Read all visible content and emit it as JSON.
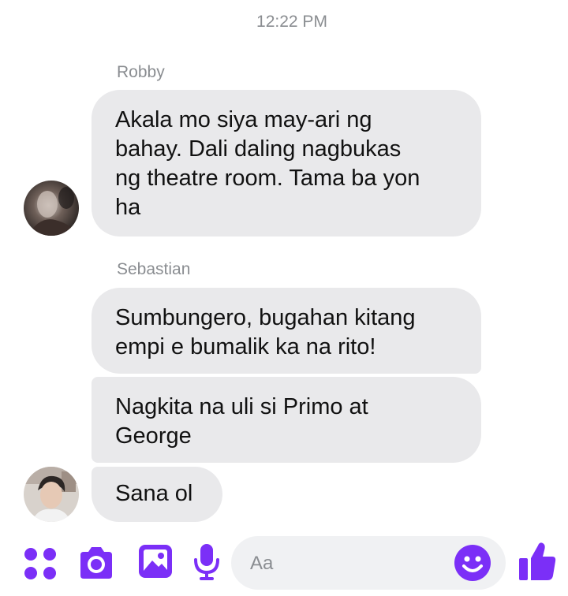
{
  "conversation": {
    "timestamp": "12:22 PM",
    "groups": [
      {
        "sender": "Robby",
        "messages": [
          [
            "Akala mo siya may-ari ng",
            "bahay. Dali daling nagbukas",
            "ng theatre room. Tama ba yon",
            "ha"
          ]
        ]
      },
      {
        "sender": "Sebastian",
        "messages": [
          [
            "Sumbungero, bugahan kitang",
            "empi e bumalik ka na rito!"
          ],
          [
            "Nagkita na uli si Primo at",
            "George"
          ],
          [
            "Sana ol"
          ]
        ]
      }
    ]
  },
  "composer": {
    "placeholder": "Aa",
    "icons": [
      "more-apps-icon",
      "camera-icon",
      "gallery-icon",
      "microphone-icon",
      "emoji-icon",
      "thumbs-up-icon"
    ]
  },
  "colors": {
    "accent": "#7b2ff7",
    "bubble": "#e9e9eb",
    "meta_text": "#8a8d91"
  }
}
